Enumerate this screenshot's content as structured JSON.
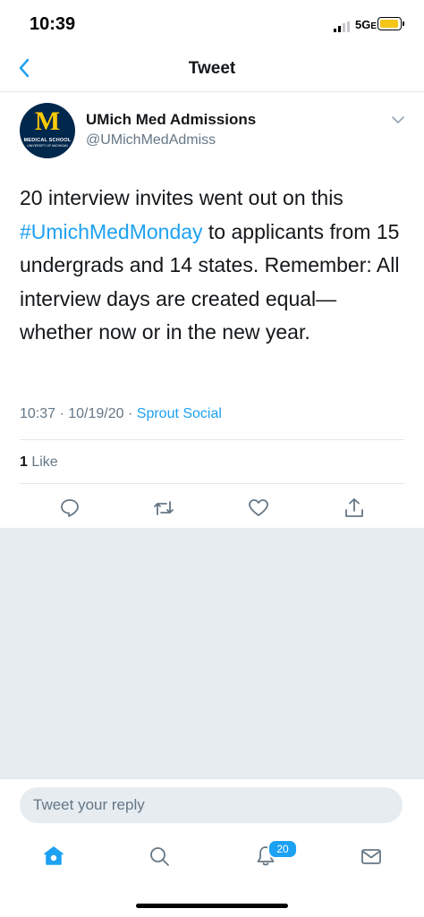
{
  "status": {
    "time": "10:39",
    "network": "5G",
    "network_suffix": "E"
  },
  "nav": {
    "title": "Tweet",
    "back_icon": "chevron-left-icon"
  },
  "author": {
    "name": "UMich Med Admissions",
    "handle": "@UMichMedAdmiss",
    "avatar": {
      "letter": "M",
      "line1": "MEDICAL SCHOOL",
      "line2": "UNIVERSITY OF MICHIGAN"
    }
  },
  "tweet": {
    "text_before": "20 interview invites went out on this ",
    "hashtag": "#UmichMedMonday",
    "text_after": " to applicants from 15 undergrads and 14 states. Remember: All interview days are created equal—whether now or in the new year.",
    "timestamp": "10:37 · 10/19/20 · ",
    "source": "Sprout Social",
    "likes_count": "1",
    "likes_label": " Like"
  },
  "actions": [
    "reply-icon",
    "retweet-icon",
    "like-icon",
    "share-icon"
  ],
  "reply": {
    "placeholder": "Tweet your reply"
  },
  "tabbar": {
    "items": [
      "home-icon",
      "search-icon",
      "notifications-icon",
      "messages-icon"
    ],
    "notifications_badge": "20"
  },
  "colors": {
    "accent": "#1da1f2",
    "secondary_text": "#657786",
    "gray_bg": "#e6ecf0"
  }
}
